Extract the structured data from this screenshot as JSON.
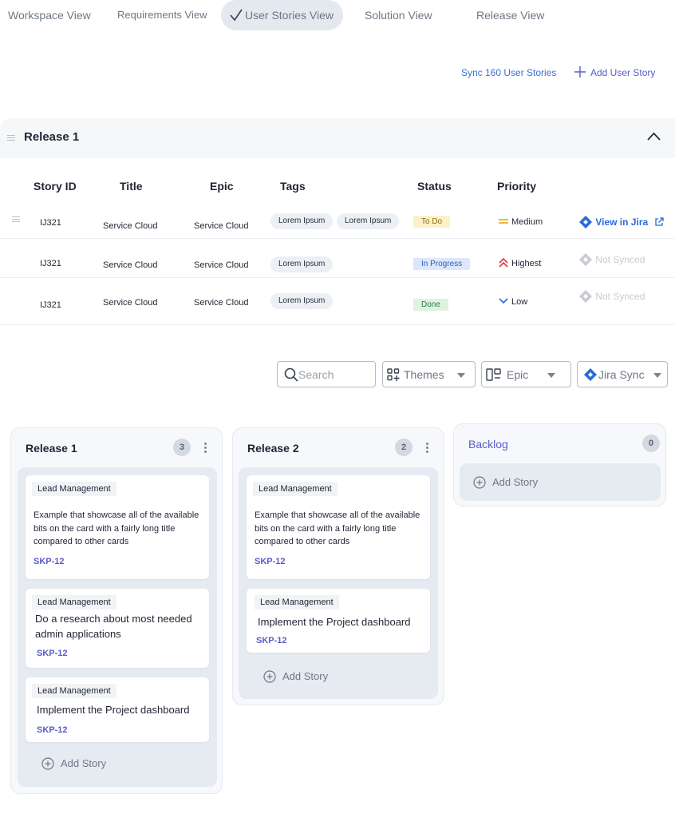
{
  "nav": {
    "tabs": [
      {
        "label": "Workspace View"
      },
      {
        "label": "Requirements View"
      },
      {
        "label": "User Stories View"
      },
      {
        "label": "Solution View"
      },
      {
        "label": "Release View"
      }
    ],
    "active_icon": "check-icon"
  },
  "actions": {
    "sync_label": "Sync 160 User Stories",
    "add_label": "Add User Story"
  },
  "release_section": {
    "title": "Release 1",
    "collapse_icon": "chevron-up-icon"
  },
  "table": {
    "headers": [
      "Story ID",
      "Title",
      "Epic",
      "Tags",
      "Status",
      "Priority"
    ],
    "rows": [
      {
        "id": "IJ321",
        "title": "Service Cloud",
        "epic": "Service Cloud",
        "tags": [
          "Lorem Ipsum",
          "Lorem Ipsum"
        ],
        "status": "To Do",
        "priority": "Medium",
        "jira": "View in Jira"
      },
      {
        "id": "IJ321",
        "title": "Service Cloud",
        "epic": "Service Cloud",
        "tags": [
          "Lorem Ipsum"
        ],
        "status": "In Progress",
        "priority": "Highest",
        "jira": "Not Synced"
      },
      {
        "id": "IJ321",
        "title": "Service Cloud",
        "epic": "Service Cloud",
        "tags": [
          "Lorem Ipsum"
        ],
        "status": "Done",
        "priority": "Low",
        "jira": "Not Synced"
      }
    ]
  },
  "filters": {
    "search_placeholder": "Search",
    "themes": "Themes",
    "epic": "Epic",
    "jira_sync": "Jira Sync"
  },
  "board": {
    "columns": [
      {
        "title": "Release 1",
        "count": "3",
        "cards": [
          {
            "tag": "Lead Management",
            "text": "Example that showcase all of the available bits on the card with a fairly long title compared to other cards",
            "key": "SKP-12"
          },
          {
            "tag": "Lead Management",
            "text": "Do a research about most needed admin applications",
            "key": "SKP-12"
          },
          {
            "tag": "Lead Management",
            "text": "Implement the Project dashboard",
            "key": "SKP-12"
          }
        ],
        "add_label": "Add Story"
      },
      {
        "title": "Release 2",
        "count": "2",
        "cards": [
          {
            "tag": "Lead Management",
            "text": "Example that showcase all of the available bits on the card with a fairly long title compared to other cards",
            "key": "SKP-12"
          },
          {
            "tag": "Lead Management",
            "text": "Implement the Project dashboard",
            "key": "SKP-12"
          }
        ],
        "add_label": "Add Story"
      },
      {
        "title": "Backlog",
        "count": "0",
        "cards": [],
        "add_label": "Add Story"
      }
    ]
  },
  "colors": {
    "accent": "#5a5cc8",
    "link": "#3b6fd0",
    "jira_blue": "#2a6ad8",
    "todo_bg": "#fdf0c9",
    "progress_bg": "#dbe7fb",
    "done_bg": "#dcf3e1",
    "priority_highest": "#d9413a",
    "priority_medium": "#e8b21a",
    "priority_low": "#2a6ad8"
  }
}
